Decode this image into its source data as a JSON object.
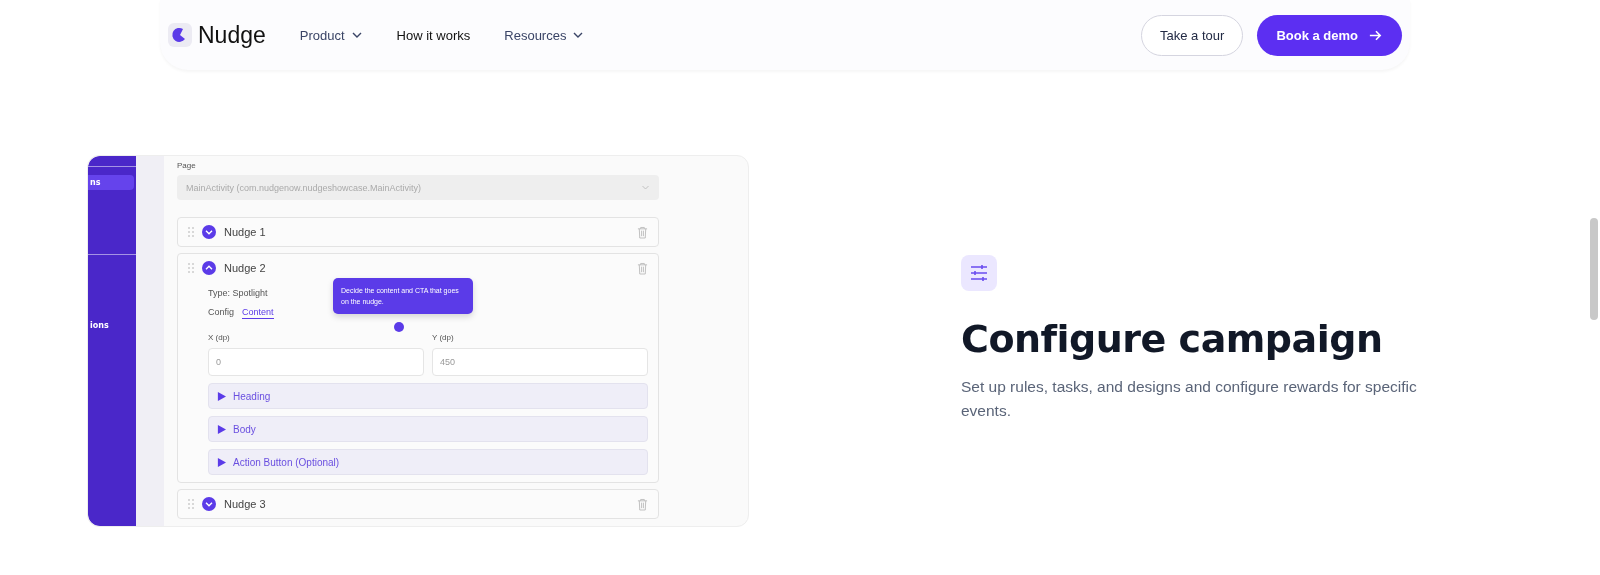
{
  "nav": {
    "logo": "Nudge",
    "links": [
      {
        "label": "Product",
        "dropdown": true
      },
      {
        "label": "How it works",
        "dropdown": false
      },
      {
        "label": "Resources",
        "dropdown": true
      }
    ],
    "buttons": [
      {
        "label": "Take a tour",
        "kind": "secondary"
      },
      {
        "label": "Book a demo",
        "kind": "primary"
      }
    ]
  },
  "preview": {
    "sidebar": [
      {
        "label": "ns",
        "selected": true
      },
      {
        "label": "ions",
        "selected": false
      }
    ],
    "page_label": "Page",
    "page_select": "MainActivity (com.nudgenow.nudgeshowcase.MainActivity)",
    "nudges": [
      {
        "title": "Nudge 1",
        "expanded": false
      },
      {
        "title": "Nudge 2",
        "expanded": true,
        "type": "Type: Spotlight",
        "tabs": [
          {
            "label": "Config",
            "selected": false
          },
          {
            "label": "Content",
            "selected": true
          }
        ],
        "fields": [
          {
            "label": "X (dp)",
            "value": "0"
          },
          {
            "label": "Y (dp)",
            "value": "450"
          }
        ],
        "sections": [
          "Heading",
          "Body",
          "Action Button (Optional)"
        ],
        "tooltip": "Decide the content and CTA that goes on the nudge."
      },
      {
        "title": "Nudge 3",
        "expanded": false
      }
    ]
  },
  "feature": {
    "title": "Configure campaign",
    "description": "Set up rules, tasks, and designs and configure rewards for specific events."
  }
}
